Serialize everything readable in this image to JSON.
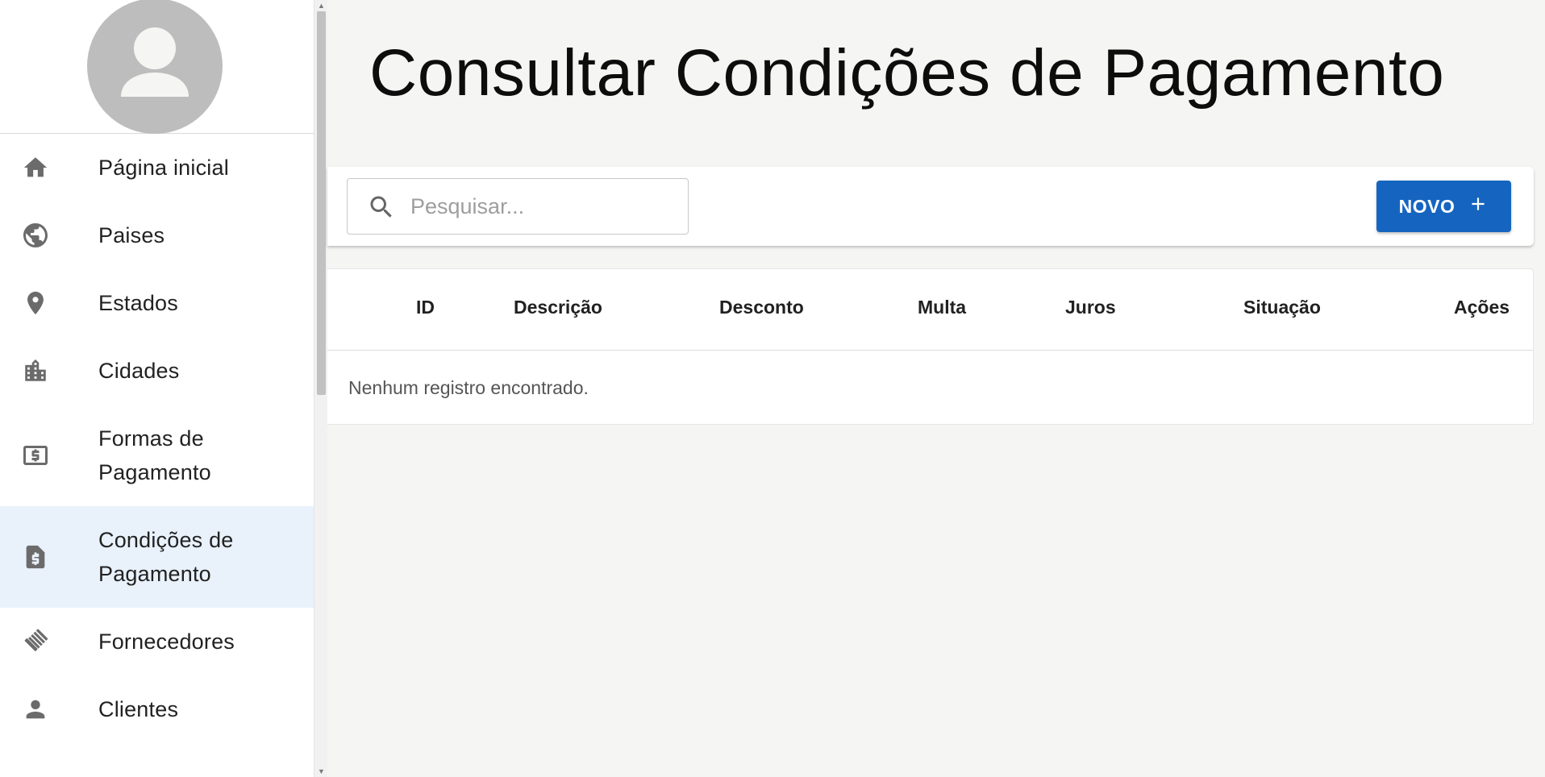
{
  "sidebar": {
    "items": [
      {
        "label": "Página inicial",
        "icon": "home-icon"
      },
      {
        "label": "Paises",
        "icon": "globe-icon"
      },
      {
        "label": "Estados",
        "icon": "location-pin-icon"
      },
      {
        "label": "Cidades",
        "icon": "city-icon"
      },
      {
        "label": "Formas de Pagamento",
        "icon": "money-icon"
      },
      {
        "label": "Condições de Pagamento",
        "icon": "invoice-icon",
        "active": true
      },
      {
        "label": "Fornecedores",
        "icon": "handshake-icon"
      },
      {
        "label": "Clientes",
        "icon": "person-icon"
      }
    ]
  },
  "page": {
    "title": "Consultar Condições de Pagamento"
  },
  "toolbar": {
    "search_placeholder": "Pesquisar...",
    "new_button_label": "NOVO"
  },
  "table": {
    "columns": [
      "ID",
      "Descrição",
      "Desconto",
      "Multa",
      "Juros",
      "Situação",
      "Ações"
    ],
    "empty_message": "Nenhum registro encontrado."
  },
  "colors": {
    "primary": "#1565c0",
    "active_nav_bg": "#e9f1fb",
    "icon_gray": "#6b6b6b",
    "page_bg": "#f5f5f3"
  }
}
